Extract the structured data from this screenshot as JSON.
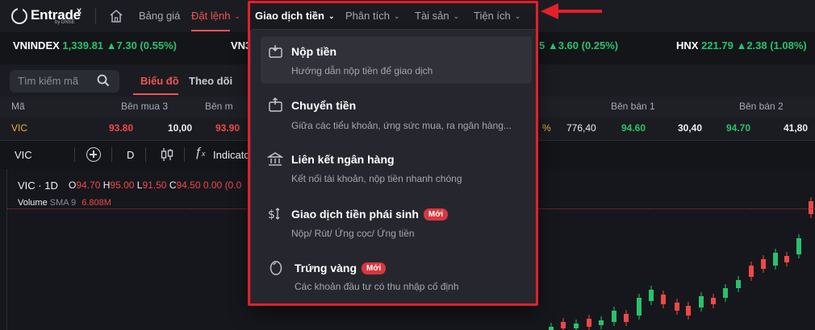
{
  "brand": {
    "name": "Entrade",
    "superscript": "X",
    "sub": "by DNSE"
  },
  "nav": {
    "items": [
      {
        "label": "Bảng giá",
        "state": "idle"
      },
      {
        "label": "Đặt lệnh",
        "state": "active"
      },
      {
        "label": "Giao dịch tiền",
        "state": "open"
      },
      {
        "label": "Phân tích",
        "state": "idle"
      },
      {
        "label": "Tài sản",
        "state": "idle"
      },
      {
        "label": "Tiện ích",
        "state": "idle"
      }
    ]
  },
  "ticker": [
    {
      "name": "VNINDEX",
      "value": "1,339.81 ▲7.30 (0.55%)"
    },
    {
      "name": "VN3",
      "value": ""
    },
    {
      "name": "",
      "value": "5 ▲3.60 (0.25%)"
    },
    {
      "name": "HNX",
      "value": "221.79 ▲2.38 (1.08%)"
    }
  ],
  "search": {
    "placeholder": "Tìm kiếm mã"
  },
  "tabs": {
    "bieu_do": "Biểu đồ",
    "theo_doi": "Theo dõi"
  },
  "orderbook": {
    "headers": {
      "ma": "Mã",
      "ben_mua_3": "Bên mua 3",
      "ben_mua_2": "Bên m",
      "ben_ban_1": "Bên bán 1",
      "ben_ban_2": "Bên bán 2"
    },
    "row": {
      "symbol": "VIC",
      "bid3_price": "93.80",
      "bid3_vol": "10,00",
      "bid2_price": "93.90",
      "pct_tail": "%",
      "mid_vol": "776,40",
      "ask1_price": "94.60",
      "ask1_vol": "30,40",
      "ask2_price": "94.70",
      "ask2_vol": "41,80"
    }
  },
  "chart_toolbar": {
    "symbol": "VIC",
    "interval": "D",
    "indicators": "Indicator"
  },
  "chart": {
    "title": "VIC · 1D",
    "ohlc": {
      "o_label": "O",
      "o": "94.70",
      "h_label": "H",
      "h": "95.00",
      "l_label": "L",
      "l": "91.50",
      "c_label": "C",
      "c": "94.50",
      "change": "0.00 (0.0"
    },
    "volume_label": "Volume",
    "sma_label": "SMA 9",
    "sma_value": "6.808M"
  },
  "dropdown": {
    "items": [
      {
        "title": "Nộp tiền",
        "desc": "Hướng dẫn nộp tiền để giao dịch",
        "badge": ""
      },
      {
        "title": "Chuyển tiền",
        "desc": "Giữa các tiểu khoản, ứng sức mua, ra ngân hàng...",
        "badge": ""
      },
      {
        "title": "Liên kết ngân hàng",
        "desc": "Kết nối tài khoản, nộp tiền nhanh chóng",
        "badge": ""
      },
      {
        "title": "Giao dịch tiền phái sinh",
        "desc": "Nộp/ Rút/ Ứng cọc/ Ứng tiền",
        "badge": "Mới"
      },
      {
        "title": "Trứng vàng",
        "desc": "Các khoản đầu tư có thu nhập cố định",
        "badge": "Mới"
      }
    ]
  },
  "colors": {
    "up": "#29c26b",
    "down": "#f04848",
    "accent": "#f05454",
    "annotation": "#e3202a"
  }
}
